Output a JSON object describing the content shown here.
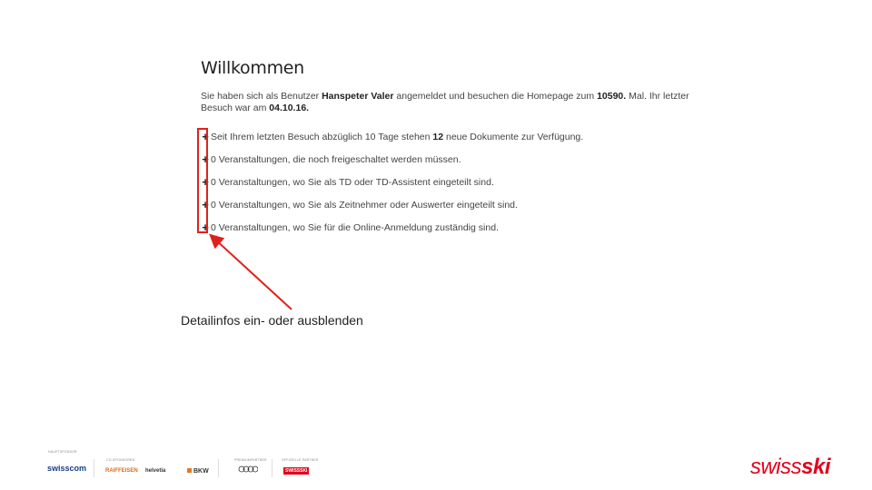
{
  "welcome": {
    "title": "Willkommen",
    "intro": {
      "t1": "Sie haben sich als Benutzer ",
      "user": "Hanspeter Valer",
      "t2": " angemeldet und besuchen die Homepage zum ",
      "count": "10590.",
      "t3": " Mal. Ihr letzter Besuch war am ",
      "date": "04.10.16."
    }
  },
  "items": [
    {
      "pre": "Seit Ihrem letzten Besuch abzüglich 10 Tage stehen ",
      "num": "12",
      "post": " neue Dokumente zur Verfügung."
    },
    {
      "pre": "0 Veranstaltungen, die noch freigeschaltet werden müssen.",
      "num": "",
      "post": ""
    },
    {
      "pre": "0 Veranstaltungen, wo Sie als TD oder TD-Assistent eingeteilt sind.",
      "num": "",
      "post": ""
    },
    {
      "pre": "0 Veranstaltungen, wo Sie als Zeitnehmer oder Auswerter eingeteilt sind.",
      "num": "",
      "post": ""
    },
    {
      "pre": "0 Veranstaltungen, wo Sie für die Online-Anmeldung zuständig sind.",
      "num": "",
      "post": ""
    }
  ],
  "toggle_symbol": "+",
  "caption": "Detailinfos ein- oder ausblenden",
  "sponsors": {
    "labels": [
      "HAUPTSPONSOR",
      "CO-SPONSOREN",
      "PREMIUMPARTNER",
      "OFFIZIELLE PARTNER"
    ],
    "logos": [
      "swisscom",
      "RAIFFEISEN",
      "helvetia",
      "BKW",
      "Audi",
      "SWISSSKI"
    ]
  },
  "brand": {
    "swiss": "swiss",
    "ski": "ski"
  },
  "colors": {
    "accent": "#e2001a",
    "highlight": "#e0211b"
  }
}
